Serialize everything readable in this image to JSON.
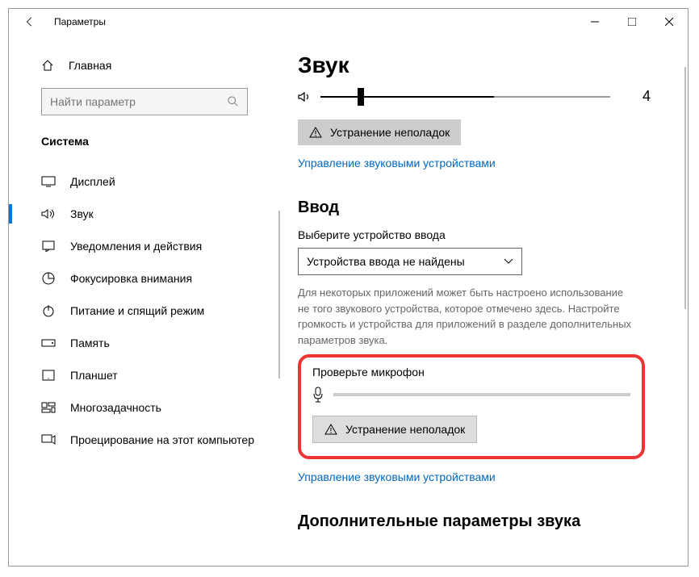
{
  "window": {
    "title": "Параметры"
  },
  "sidebar": {
    "home": "Главная",
    "search_placeholder": "Найти параметр",
    "category": "Система",
    "items": [
      {
        "label": "Дисплей",
        "icon": "display"
      },
      {
        "label": "Звук",
        "icon": "sound",
        "active": true
      },
      {
        "label": "Уведомления и действия",
        "icon": "notify"
      },
      {
        "label": "Фокусировка внимания",
        "icon": "focus"
      },
      {
        "label": "Питание и спящий режим",
        "icon": "power"
      },
      {
        "label": "Память",
        "icon": "storage"
      },
      {
        "label": "Планшет",
        "icon": "tablet"
      },
      {
        "label": "Многозадачность",
        "icon": "multitask"
      },
      {
        "label": "Проецирование на этот компьютер",
        "icon": "project"
      }
    ]
  },
  "main": {
    "heading": "Звук",
    "volume": {
      "value": 4,
      "percent": 60
    },
    "troubleshoot1": "Устранение неполадок",
    "manage1": "Управление звуковыми устройствами",
    "input": {
      "heading": "Ввод",
      "choose": "Выберите устройство ввода",
      "selected": "Устройства ввода не найдены",
      "note": "Для некоторых приложений может быть настроено использование не того звукового устройства, которое отмечено здесь. Настройте громкость и устройства для приложений в разделе дополнительных параметров звука.",
      "test": "Проверьте микрофон",
      "troubleshoot2": "Устранение неполадок",
      "manage2": "Управление звуковыми устройствами"
    },
    "advanced": "Дополнительные параметры звука"
  }
}
